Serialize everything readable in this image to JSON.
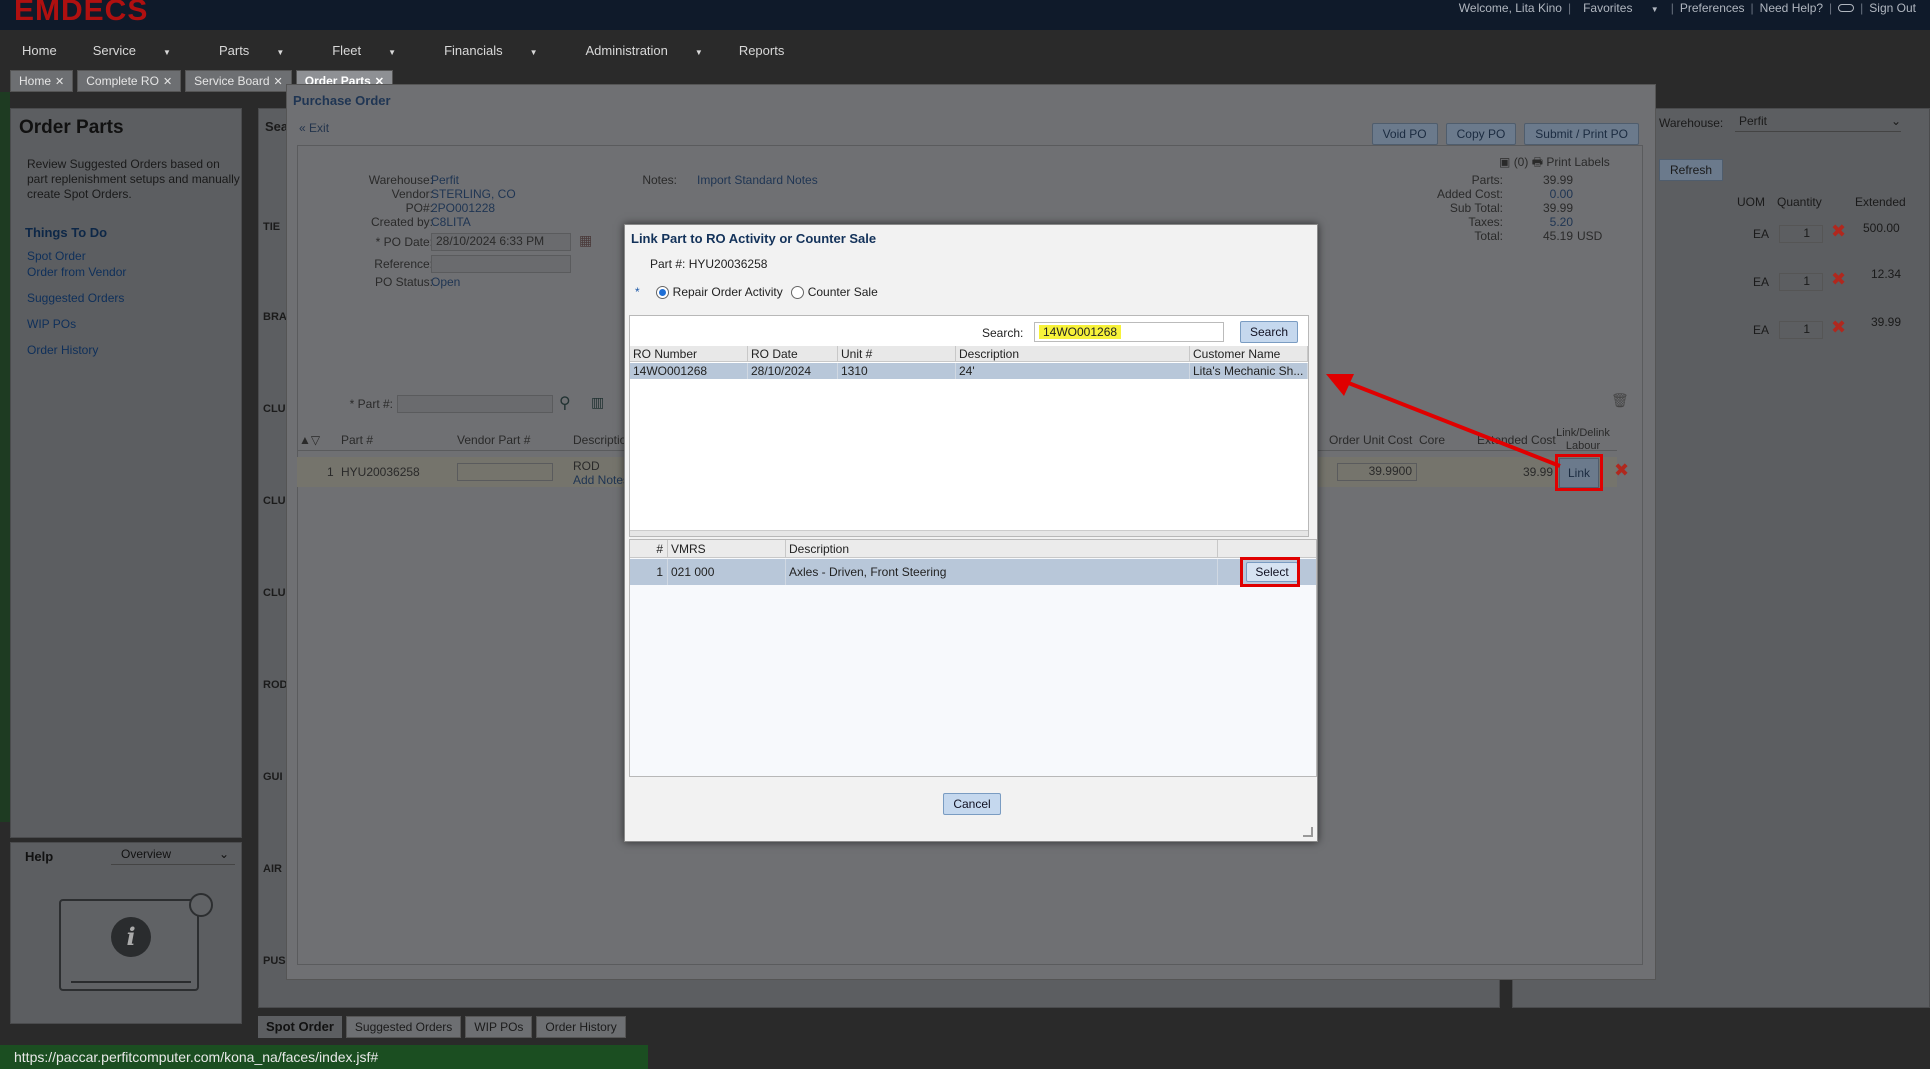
{
  "app": {
    "logo": "EMDECS",
    "top_links": [
      "Welcome, Lita Kino",
      "Favorites",
      "Preferences",
      "Need Help?",
      "Sign Out"
    ]
  },
  "nav": {
    "items": [
      "Home",
      "Service",
      "Parts",
      "Fleet",
      "Financials",
      "Administration",
      "Reports"
    ]
  },
  "tabs": [
    {
      "label": "Home",
      "active": false
    },
    {
      "label": "Complete RO",
      "active": false
    },
    {
      "label": "Service Board",
      "active": false
    },
    {
      "label": "Order Parts",
      "active": true
    }
  ],
  "left_panel": {
    "title": "Order Parts",
    "description": "Review Suggested Orders based on part replenishment setups and manually create Spot Orders.",
    "things_to_do": "Things To Do",
    "links": [
      "Spot Order",
      "Order from Vendor",
      "Suggested Orders",
      "WIP POs",
      "Order History"
    ]
  },
  "help": {
    "title": "Help",
    "selected": "Overview"
  },
  "background": {
    "search_label": "Sea",
    "row_labels": [
      "TIE",
      "BRA",
      "CLU",
      "CLU",
      "CLU",
      "ROD",
      "GUI",
      "AIR",
      "PUS"
    ],
    "bottom_tabs": [
      "Spot Order",
      "Suggested Orders",
      "WIP POs",
      "Order History"
    ],
    "right": {
      "warehouse_label": "Warehouse:",
      "warehouse_value": "Perfit",
      "refresh": "Refresh",
      "headers": [
        "UOM",
        "Quantity",
        "Extended"
      ],
      "rows": [
        {
          "uom": "EA",
          "qty": "1",
          "ext": "500.00"
        },
        {
          "uom": "EA",
          "qty": "1",
          "ext": "12.34"
        },
        {
          "uom": "EA",
          "qty": "1",
          "ext": "39.99"
        }
      ]
    }
  },
  "po": {
    "title": "Purchase Order",
    "exit": "Exit",
    "buttons": [
      "Void PO",
      "Copy PO",
      "Submit / Print PO"
    ],
    "labels_count": "(0)",
    "print_labels": "Print Labels",
    "fields": {
      "warehouse_label": "Warehouse:",
      "warehouse": "Perfit",
      "vendor_label": "Vendor:",
      "vendor": "STERLING, CO",
      "po_label": "PO#:",
      "po": "2PO001228",
      "created_label": "Created by:",
      "created": "C8LITA",
      "date_label": "* PO Date:",
      "date": "28/10/2024 6:33 PM",
      "reference_label": "Reference:",
      "status_label": "PO Status:",
      "status": "Open",
      "notes_label": "Notes:",
      "notes_link": "Import Standard Notes"
    },
    "summary": [
      {
        "label": "Parts:",
        "value": "39.99"
      },
      {
        "label": "Added Cost:",
        "value": "0.00"
      },
      {
        "label": "Sub Total:",
        "value": "39.99"
      },
      {
        "label": "Taxes:",
        "value": "5.20"
      },
      {
        "label": "Total:",
        "value": "45.19",
        "unit": "USD"
      }
    ],
    "part_input_label": "* Part #:",
    "grid_headers": [
      "Part #",
      "Vendor Part #",
      "Description",
      "Order Unit Cost",
      "Core",
      "Extended Cost",
      "Link/Delink Labour"
    ],
    "row": {
      "num": "1",
      "part": "HYU20036258",
      "desc": "ROD",
      "add_notes": "Add Notes",
      "unit_cost": "39.9900",
      "extended": "39.99",
      "link": "Link"
    }
  },
  "modal": {
    "title": "Link Part to RO Activity or Counter Sale",
    "part_label": "Part #:",
    "part_value": "HYU20036258",
    "required_mark": "*",
    "radio_repair": "Repair Order Activity",
    "radio_counter": "Counter Sale",
    "search_label": "Search:",
    "search_value": "14WO001268",
    "search_button": "Search",
    "ro_headers": [
      "RO Number",
      "RO Date",
      "Unit #",
      "Description",
      "Customer Name"
    ],
    "ro_rows": [
      {
        "ro": "14WO001268",
        "date": "28/10/2024",
        "unit": "1310",
        "desc": "24'",
        "customer": "Lita's Mechanic Sh..."
      }
    ],
    "vmrs_headers": [
      "#",
      "VMRS",
      "Description"
    ],
    "vmrs_rows": [
      {
        "num": "1",
        "vmrs": "021 000",
        "desc": "Axles - Driven, Front Steering",
        "action": "Select"
      }
    ],
    "cancel": "Cancel"
  },
  "status_url": "https://paccar.perfitcomputer.com/kona_na/faces/index.jsf#",
  "colors": {
    "highlight_red": "#e00000",
    "search_highlight": "#f7f23a",
    "selected_row": "#b8c7d9"
  }
}
